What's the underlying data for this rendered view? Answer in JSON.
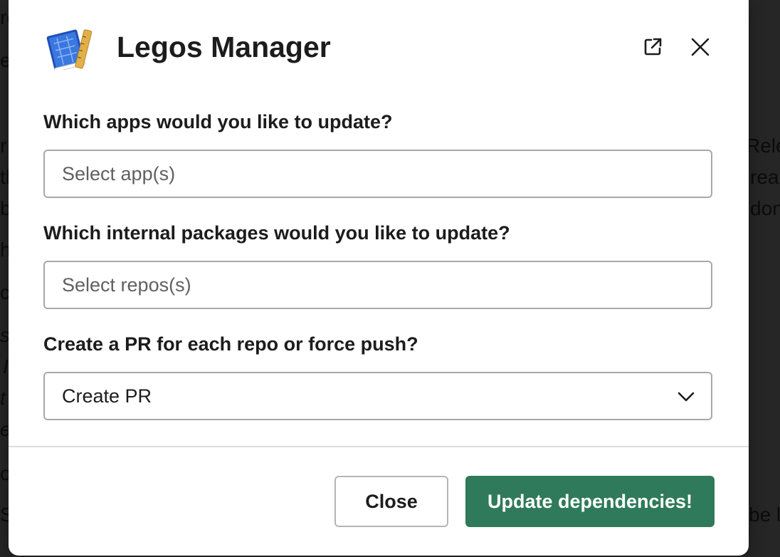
{
  "background": {
    "fragments": [
      {
        "text": "ro"
      },
      {
        "text": "e"
      },
      {
        "text": "r"
      },
      {
        "text": "th"
      },
      {
        "text": "b"
      },
      {
        "text": "h"
      },
      {
        "text": "ca"
      },
      {
        "text": "s"
      },
      {
        "text": "I"
      },
      {
        "text": "t"
      },
      {
        "text": "e"
      },
      {
        "text": "o"
      },
      {
        "text": "Sa"
      },
      {
        "text": "Rele"
      },
      {
        "text": "rea"
      },
      {
        "text": "don"
      },
      {
        "text": "be l"
      }
    ]
  },
  "modal": {
    "title": "Legos Manager",
    "icons": {
      "app": "blueprint-ruler-icon",
      "open_external": "external-link-icon",
      "close": "close-icon"
    },
    "fields": [
      {
        "label": "Which apps would you like to update?",
        "placeholder": "Select app(s)"
      },
      {
        "label": "Which internal packages would you like to update?",
        "placeholder": "Select repos(s)"
      },
      {
        "label": "Create a PR for each repo or force push?",
        "value": "Create PR"
      }
    ],
    "buttons": {
      "close": "Close",
      "submit": "Update dependencies!"
    },
    "colors": {
      "primary": "#2f7a5a",
      "text": "#1d1c1d"
    }
  }
}
